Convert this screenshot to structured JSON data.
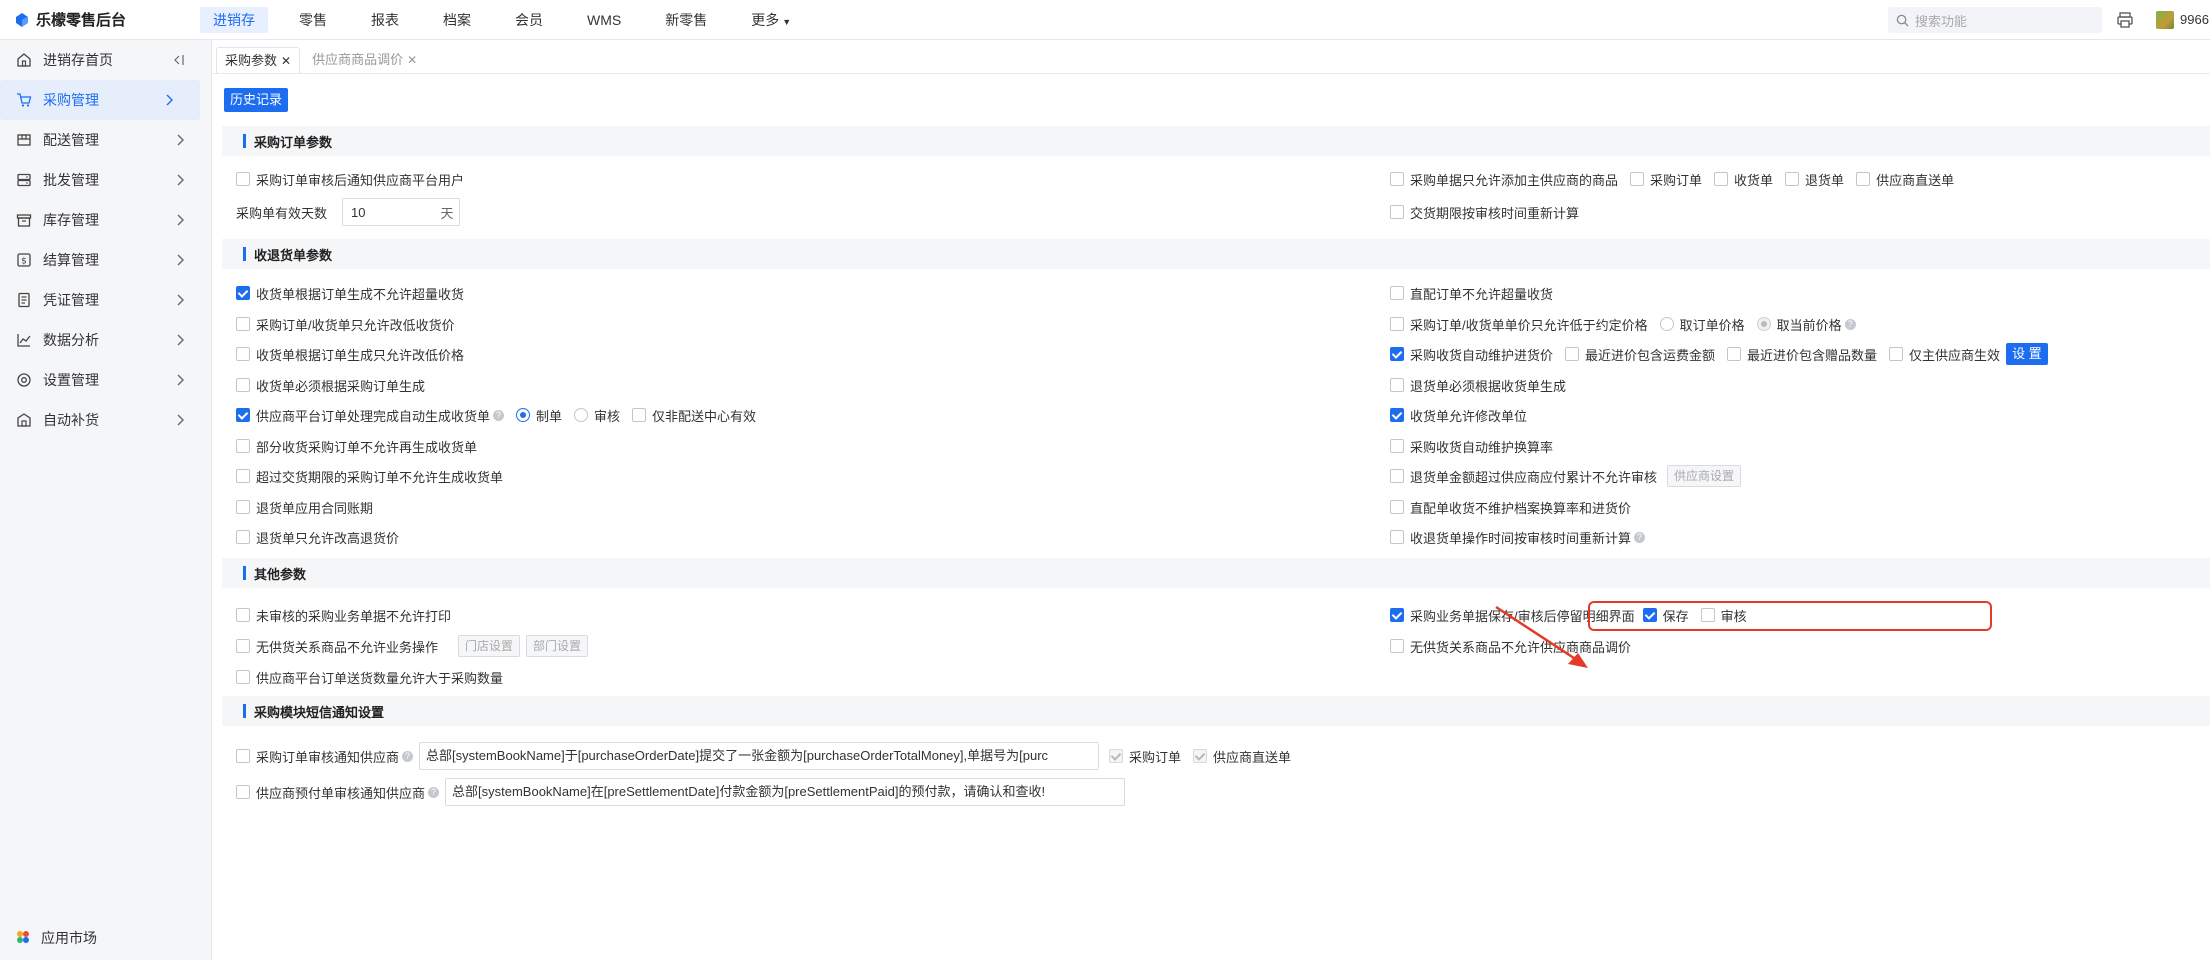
{
  "app": {
    "title": "乐檬零售后台"
  },
  "topnav": [
    {
      "label": "进销存",
      "active": true
    },
    {
      "label": "零售"
    },
    {
      "label": "报表"
    },
    {
      "label": "档案"
    },
    {
      "label": "会员"
    },
    {
      "label": "WMS"
    },
    {
      "label": "新零售"
    },
    {
      "label": "更多"
    }
  ],
  "search": {
    "placeholder": "搜索功能"
  },
  "user": {
    "name": "9966"
  },
  "sidebar": {
    "items": [
      {
        "label": "进销存首页",
        "icon": "home-icon"
      },
      {
        "label": "采购管理",
        "icon": "cart-icon",
        "active": true
      },
      {
        "label": "配送管理",
        "icon": "delivery-icon"
      },
      {
        "label": "批发管理",
        "icon": "server-icon"
      },
      {
        "label": "库存管理",
        "icon": "box-icon"
      },
      {
        "label": "结算管理",
        "icon": "currency-icon"
      },
      {
        "label": "凭证管理",
        "icon": "document-icon"
      },
      {
        "label": "数据分析",
        "icon": "chart-icon"
      },
      {
        "label": "设置管理",
        "icon": "gear-icon"
      },
      {
        "label": "自动补货",
        "icon": "building-icon"
      }
    ],
    "bottom": "应用市场"
  },
  "tabs": [
    {
      "label": "采购参数",
      "active": true
    },
    {
      "label": "供应商商品调价"
    }
  ],
  "history_button": "历史记录",
  "sections": {
    "order": {
      "title": "采购订单参数",
      "notify_supplier": "采购订单审核后通知供应商平台用户",
      "valid_days_label": "采购单有效天数",
      "valid_days_value": "10",
      "valid_days_unit": "天",
      "only_main_supplier": "采购单据只允许添加主供应商的商品",
      "doc_purchase_order": "采购订单",
      "doc_receipt": "收货单",
      "doc_return": "退货单",
      "doc_direct": "供应商直送单",
      "recalc_delivery": "交货期限按审核时间重新计算"
    },
    "receipt": {
      "title": "收退货单参数",
      "left": [
        {
          "label": "收货单根据订单生成不允许超量收货",
          "checked": true
        },
        {
          "label": "采购订单/收货单只允许改低收货价",
          "checked": false
        },
        {
          "label": "收货单根据订单生成只允许改低价格",
          "checked": false
        },
        {
          "label": "收货单必须根据采购订单生成",
          "checked": false
        },
        {
          "label": "供应商平台订单处理完成自动生成收货单",
          "checked": true
        },
        {
          "label": "部分收货采购订单不允许再生成收货单",
          "checked": false
        },
        {
          "label": "超过交货期限的采购订单不允许生成收货单",
          "checked": false
        },
        {
          "label": "退货单应用合同账期",
          "checked": false
        },
        {
          "label": "退货单只允许改高退货价",
          "checked": false
        }
      ],
      "radio_make": "制单",
      "radio_audit": "审核",
      "only_nondist": "仅非配送中心有效",
      "right": [
        {
          "label": "直配订单不允许超量收货",
          "checked": false
        },
        {
          "label": "采购订单/收货单单价只允许低于约定价格",
          "checked": false
        },
        {
          "label": "采购收货自动维护进货价",
          "checked": true
        },
        {
          "label": "退货单必须根据收货单生成",
          "checked": false
        },
        {
          "label": "收货单允许修改单位",
          "checked": true
        },
        {
          "label": "采购收货自动维护换算率",
          "checked": false
        },
        {
          "label": "退货单金额超过供应商应付累计不允许审核",
          "checked": false
        },
        {
          "label": "直配单收货不维护档案换算率和进货价",
          "checked": false
        },
        {
          "label": "收退货单操作时间按审核时间重新计算",
          "checked": false
        }
      ],
      "take_order_price": "取订单价格",
      "take_current_price": "取当前价格",
      "recent_freight": "最近进价包含运费金额",
      "recent_gift": "最近进价包含赠品数量",
      "main_supplier_only": "仅主供应商生效",
      "settings_button": "设 置",
      "supplier_settings": "供应商设置"
    },
    "other": {
      "title": "其他参数",
      "no_print_unaudited": "未审核的采购业务单据不允许打印",
      "no_relation_op": "无供货关系商品不允许业务操作",
      "store_settings": "门店设置",
      "dept_settings": "部门设置",
      "allow_exceed_qty": "供应商平台订单送货数量允许大于采购数量",
      "stay_detail": "采购业务单据保存/审核后停留明细界面",
      "stay_save": "保存",
      "stay_audit": "审核",
      "no_relation_price": "无供货关系商品不允许供应商商品调价"
    },
    "sms": {
      "title": "采购模块短信通知设置",
      "order_notify": "采购订单审核通知供应商",
      "order_template": "总部[systemBookName]于[purchaseOrderDate]提交了一张金额为[purchaseOrderTotalMoney],单据号为[purc",
      "sms_purchase_order": "采购订单",
      "sms_direct": "供应商直送单",
      "prepay_notify": "供应商预付单审核通知供应商",
      "prepay_template": "总部[systemBookName]在[preSettlementDate]付款金额为[preSettlementPaid]的预付款，请确认和查收!"
    }
  },
  "colors": {
    "accent": "#1d6df0",
    "annotation": "#e53a2a"
  }
}
